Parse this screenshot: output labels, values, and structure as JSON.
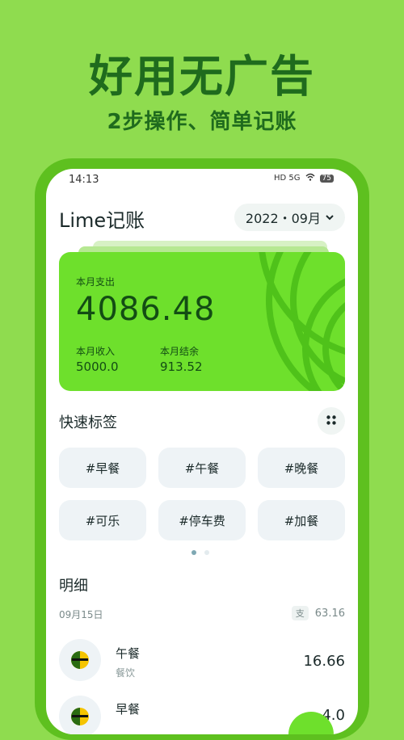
{
  "hero": {
    "title": "好用无广告",
    "subtitle": "2步操作、简单记账"
  },
  "status_bar": {
    "time": "14:13",
    "indicators": "HD 5G",
    "battery": "75"
  },
  "header": {
    "app_title": "Lime记账",
    "month": "2022・09月"
  },
  "summary_card": {
    "expense_label": "本月支出",
    "expense_value": "4086.48",
    "income_label": "本月收入",
    "income_value": "5000.0",
    "balance_label": "本月结余",
    "balance_value": "913.52"
  },
  "quick_tags": {
    "title": "快速标签",
    "tags": [
      "#早餐",
      "#午餐",
      "#晚餐",
      "#可乐",
      "#停车费",
      "#加餐"
    ]
  },
  "details": {
    "title": "明细",
    "date": "09月15日",
    "day_badge": "支",
    "day_total": "63.16",
    "items": [
      {
        "name": "午餐",
        "category": "餐饮",
        "amount": "16.66"
      },
      {
        "name": "早餐",
        "category": "",
        "amount": "4.0"
      }
    ]
  },
  "colors": {
    "accent": "#6ee02c",
    "background": "#8fdc4f",
    "dark_green": "#1f6b1d"
  }
}
